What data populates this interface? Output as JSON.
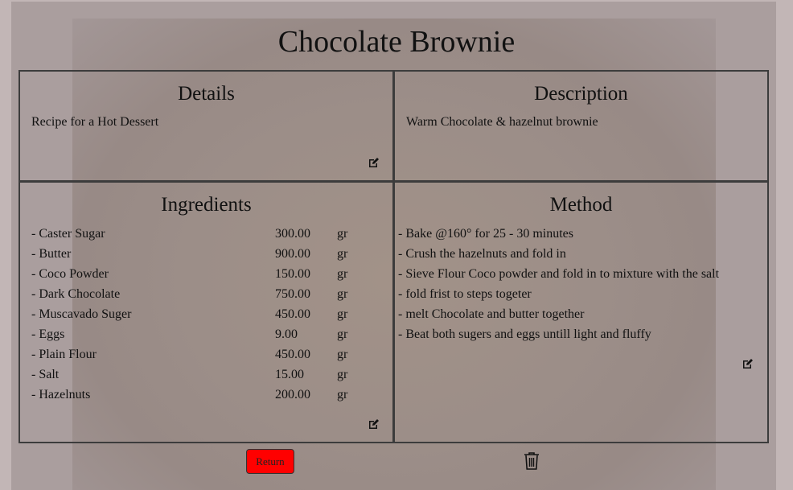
{
  "title": "Chocolate Brownie",
  "details": {
    "heading": "Details",
    "text": "Recipe for a Hot Dessert"
  },
  "description": {
    "heading": "Description",
    "text": "Warm Chocolate & hazelnut brownie"
  },
  "ingredients": {
    "heading": "Ingredients",
    "items": [
      {
        "name": "- Caster Sugar",
        "qty": "300.00",
        "unit": "gr"
      },
      {
        "name": "- Butter",
        "qty": "900.00",
        "unit": "gr"
      },
      {
        "name": "- Coco Powder",
        "qty": "150.00",
        "unit": "gr"
      },
      {
        "name": "- Dark Chocolate",
        "qty": "750.00",
        "unit": "gr"
      },
      {
        "name": "- Muscavado Suger",
        "qty": "450.00",
        "unit": "gr"
      },
      {
        "name": "- Eggs",
        "qty": "9.00",
        "unit": "gr"
      },
      {
        "name": "- Plain Flour",
        "qty": "450.00",
        "unit": "gr"
      },
      {
        "name": "- Salt",
        "qty": "15.00",
        "unit": "gr"
      },
      {
        "name": "- Hazelnuts",
        "qty": "200.00",
        "unit": "gr"
      }
    ]
  },
  "method": {
    "heading": "Method",
    "steps": [
      "- Bake @160° for 25 - 30 minutes",
      "- Crush the hazelnuts and fold in",
      "- Sieve Flour Coco powder and fold in to mixture with the salt",
      "- fold frist to steps togeter",
      "- melt Chocolate and butter together",
      "- Beat both sugers and eggs untill light and fluffy"
    ]
  },
  "buttons": {
    "return": "Return"
  }
}
